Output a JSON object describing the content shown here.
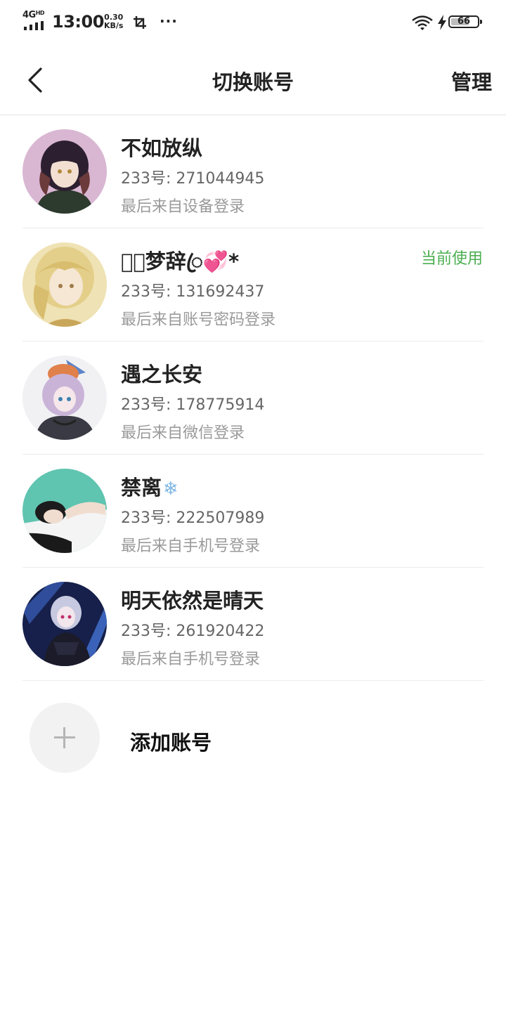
{
  "status_bar": {
    "network": "4G",
    "network_sup": "HD",
    "time": "13:00",
    "speed_value": "0.30",
    "speed_unit": "KB/s",
    "more": "···",
    "battery": "66"
  },
  "header": {
    "title": "切换账号",
    "manage_label": "管理"
  },
  "accounts": [
    {
      "name": "不如放纵",
      "uid": "233号: 271044945",
      "login": "最后来自设备登录",
      "badge": ""
    },
    {
      "name": "𝓜ꦿ梦辞ꦿ💞*",
      "uid": "233号: 131692437",
      "login": "最后来自账号密码登录",
      "badge": "当前使用"
    },
    {
      "name": "遇之长安",
      "uid": "233号: 178775914",
      "login": "最后来自微信登录",
      "badge": ""
    },
    {
      "name": "禁离",
      "name_emoji": "❄",
      "uid": "233号: 222507989",
      "login": "最后来自手机号登录",
      "badge": ""
    },
    {
      "name": "明天依然是晴天",
      "uid": "233号: 261920422",
      "login": "最后来自手机号登录",
      "badge": ""
    }
  ],
  "add_account_label": "添加账号",
  "colors": {
    "current_badge": "#4caf50",
    "secondary_text": "#666666",
    "tertiary_text": "#9a9a9a"
  }
}
